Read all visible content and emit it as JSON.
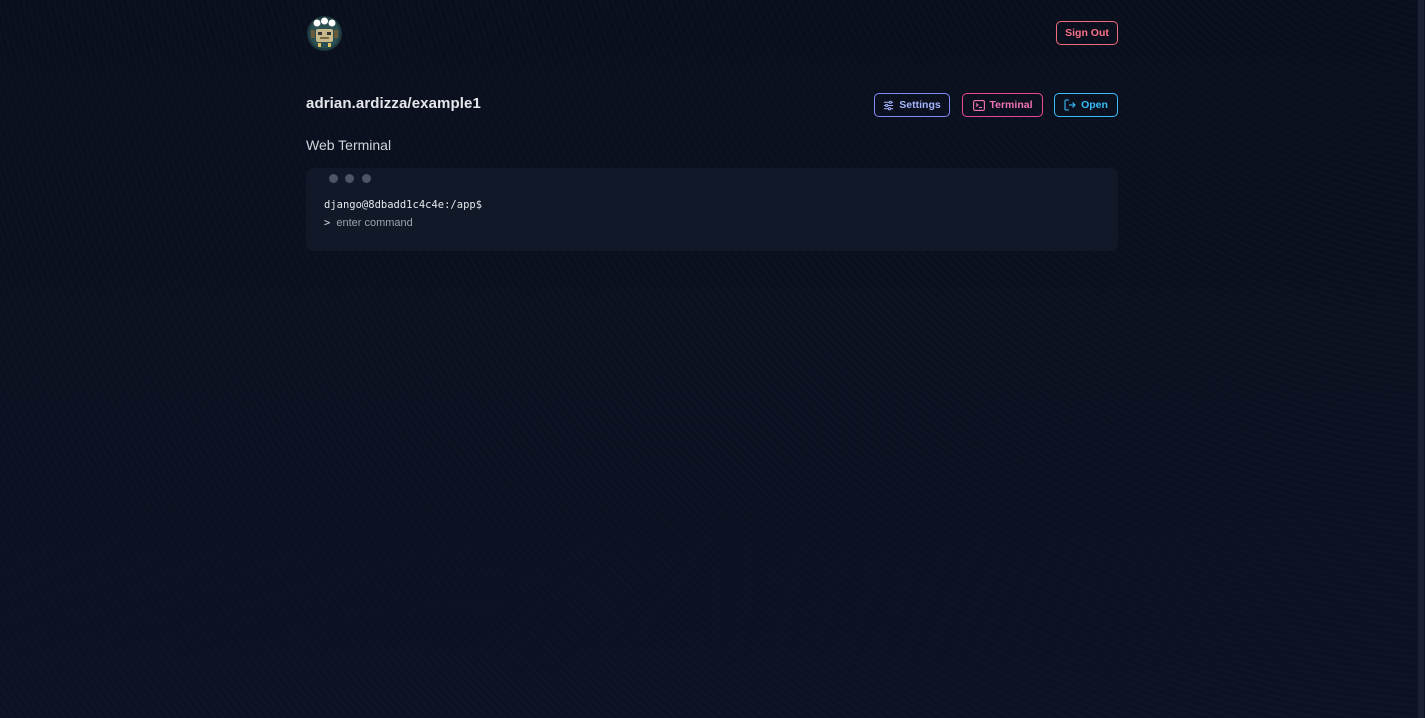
{
  "header": {
    "logo_icon": "robot-avatar-icon",
    "sign_out_label": "Sign Out"
  },
  "repo": {
    "title": "adrian.ardizza/example1"
  },
  "actions": {
    "settings_label": "Settings",
    "terminal_label": "Terminal",
    "open_label": "Open"
  },
  "terminal": {
    "section_title": "Web Terminal",
    "prompt": "django@8dbadd1c4c4e:/app$",
    "caret": ">",
    "input_placeholder": "enter command",
    "input_value": ""
  },
  "colors": {
    "background": "#0a0f1d",
    "panel": "#111827",
    "sign_out": "#fb7185",
    "settings": "#a5b4fc",
    "terminal": "#f472b6",
    "open": "#38bdf8"
  }
}
